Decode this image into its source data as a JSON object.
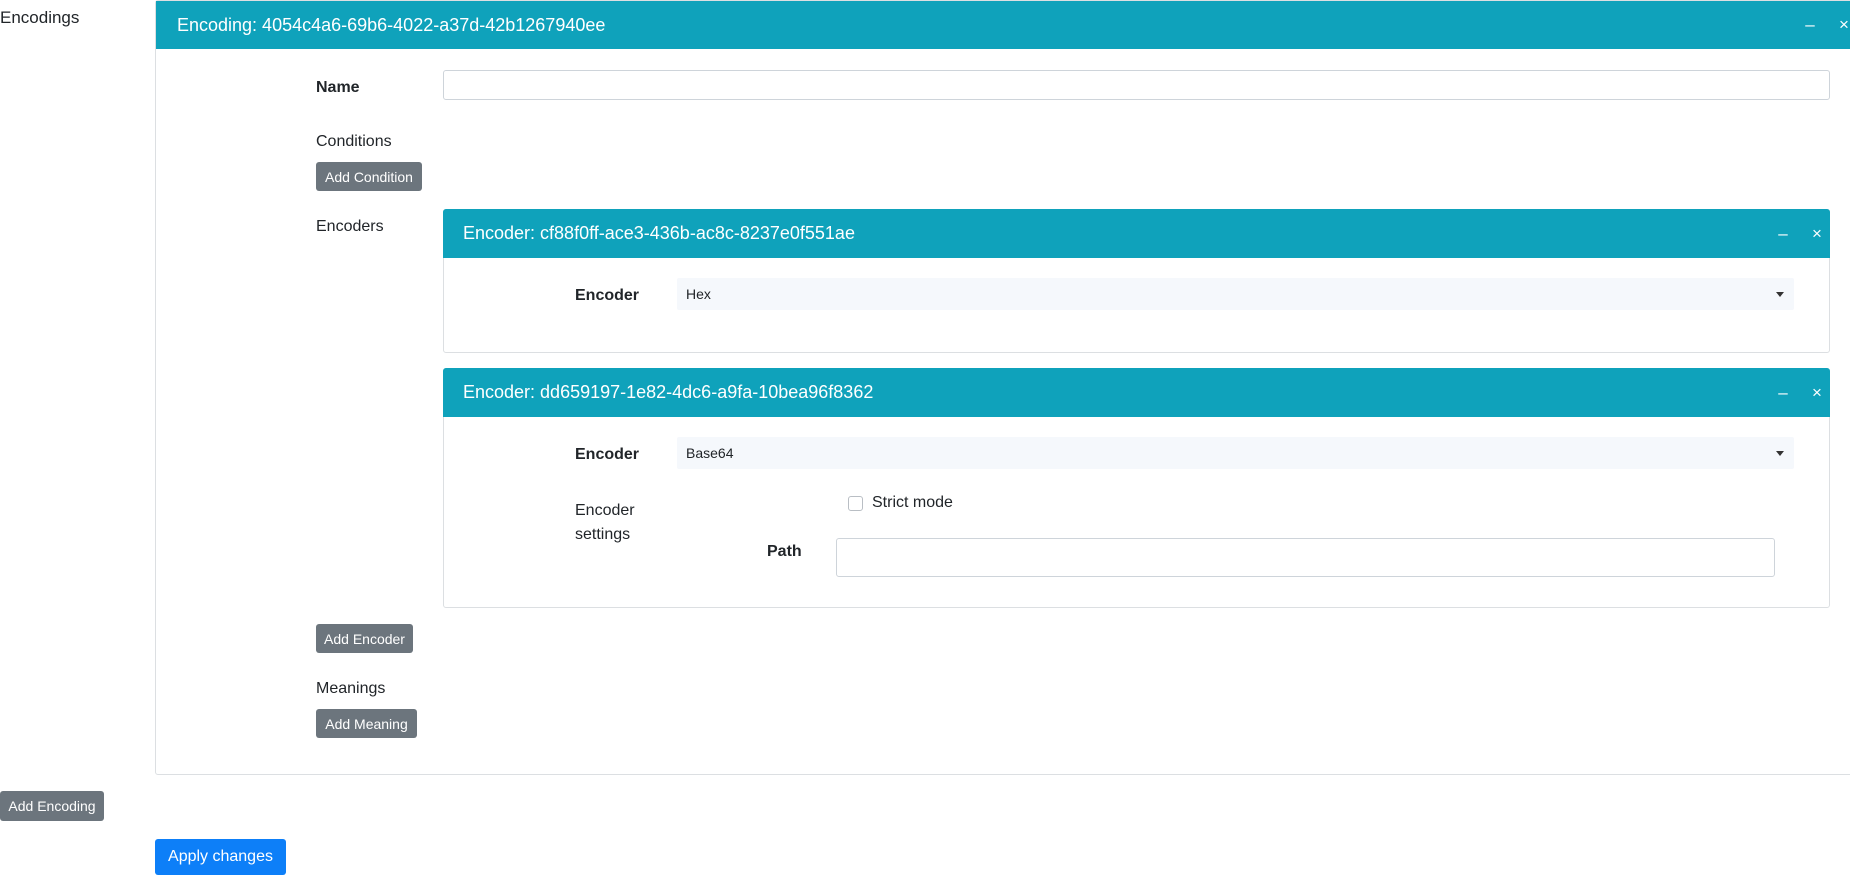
{
  "sidebar": {
    "label": "Encodings"
  },
  "encoding": {
    "title": "Encoding: 4054c4a6-69b6-4022-a37d-42b1267940ee",
    "minimize_glyph": "–",
    "close_glyph": "×",
    "name_label": "Name",
    "name_value": "",
    "conditions_label": "Conditions",
    "add_condition_label": "Add Condition",
    "encoders_label": "Encoders",
    "encoders": [
      {
        "title": "Encoder: cf88f0ff-ace3-436b-ac8c-8237e0f551ae",
        "encoder_label": "Encoder",
        "encoder_value": "Hex"
      },
      {
        "title": "Encoder: dd659197-1e82-4dc6-a9fa-10bea96f8362",
        "encoder_label": "Encoder",
        "encoder_value": "Base64",
        "settings_label_line1": "Encoder",
        "settings_label_line2": "settings",
        "strict_mode_label": "Strict mode",
        "strict_mode_checked": false,
        "path_label": "Path",
        "path_value": ""
      }
    ],
    "add_encoder_label": "Add Encoder",
    "meanings_label": "Meanings",
    "add_meaning_label": "Add Meaning"
  },
  "add_encoding_label": "Add Encoding",
  "apply_changes_label": "Apply changes",
  "icons": {
    "minimize": "minimize-icon",
    "close": "close-icon",
    "dropdown": "chevron-down-icon"
  },
  "colors": {
    "header": "#0fa2bb",
    "primary": "#0d7ff8",
    "secondary": "#6c757d"
  }
}
